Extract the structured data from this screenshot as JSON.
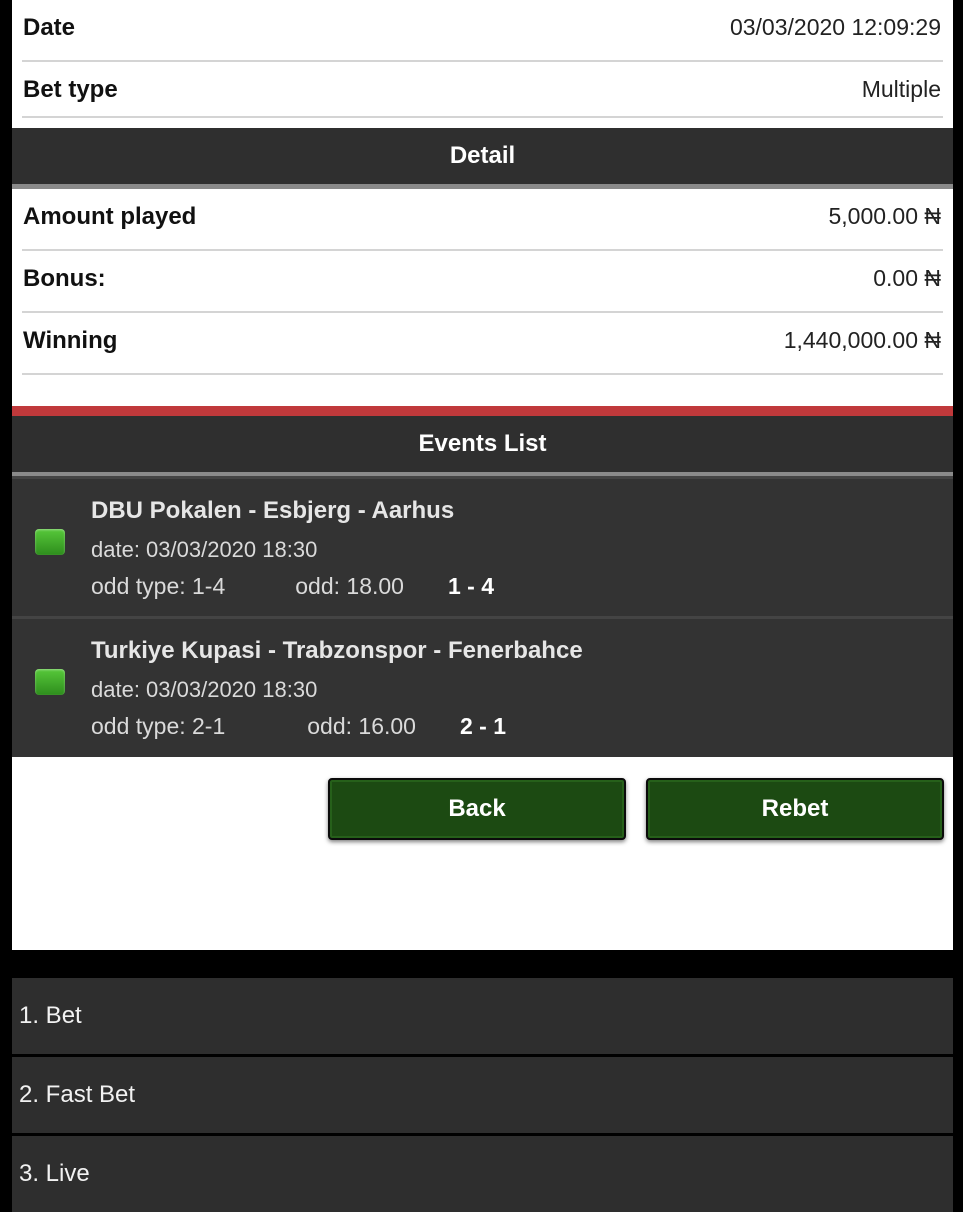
{
  "summary": {
    "date_label": "Date",
    "date_value": "03/03/2020 12:09:29",
    "bet_type_label": "Bet type",
    "bet_type_value": "Multiple"
  },
  "detail": {
    "header": "Detail",
    "amount_label": "Amount played",
    "amount_value": "5,000.00 ₦",
    "bonus_label": "Bonus:",
    "bonus_value": "0.00 ₦",
    "winning_label": "Winning",
    "winning_value": "1,440,000.00 ₦"
  },
  "events": {
    "header": "Events List",
    "items": [
      {
        "title": "DBU Pokalen - Esbjerg - Aarhus",
        "date": "date: 03/03/2020 18:30",
        "odd_type": "odd type: 1-4",
        "odd": "odd: 18.00",
        "score": "1 - 4",
        "status_color": "#3fb02a"
      },
      {
        "title": "Turkiye Kupasi - Trabzonspor - Fenerbahce",
        "date": "date: 03/03/2020 18:30",
        "odd_type": "odd type: 2-1",
        "odd": "odd: 16.00",
        "score": "2 - 1",
        "status_color": "#3fb02a"
      }
    ]
  },
  "actions": {
    "back_label": "Back",
    "rebet_label": "Rebet"
  },
  "menu": {
    "items": [
      {
        "label": "1. Bet"
      },
      {
        "label": "2. Fast Bet"
      },
      {
        "label": "3. Live"
      }
    ]
  },
  "colors": {
    "accent_red": "#c0393b",
    "button_green": "#1c4a12",
    "header_dark": "#2f2f2f"
  }
}
